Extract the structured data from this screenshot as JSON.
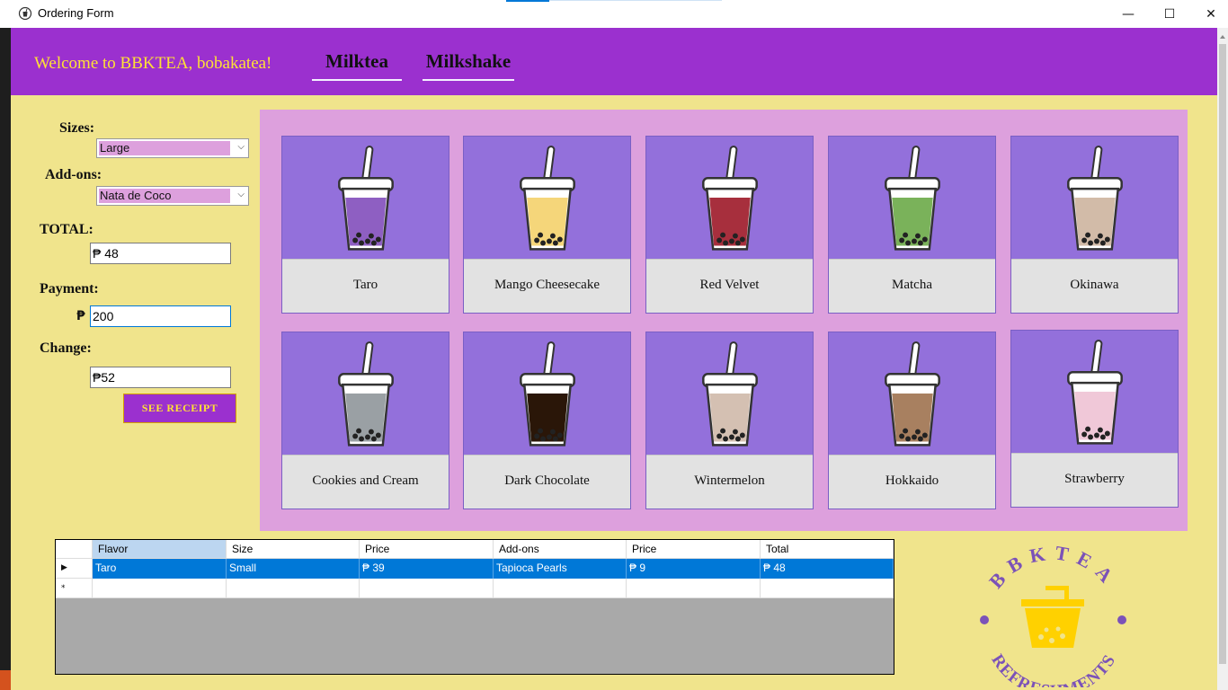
{
  "window": {
    "title": "Ordering Form",
    "controls": {
      "minimize": "—",
      "maximize": "☐",
      "close": "✕"
    }
  },
  "header": {
    "welcome": "Welcome to BBKTEA, bobakatea!",
    "tabs": [
      {
        "label": "Milktea"
      },
      {
        "label": "Milkshake"
      }
    ]
  },
  "order_form": {
    "sizes_label": "Sizes:",
    "size_value": "Large",
    "addons_label": "Add-ons:",
    "addon_value": "Nata de Coco",
    "total_label": "TOTAL:",
    "total_value": "₱ 48",
    "payment_label": "Payment:",
    "payment_currency": "₱",
    "payment_value": "200",
    "change_label": "Change:",
    "change_value": "₱52",
    "receipt_button": "SEE RECEIPT"
  },
  "products": [
    {
      "name": "Taro",
      "color": "#8e5fc2"
    },
    {
      "name": "Mango Cheesecake",
      "color": "#f5d67a"
    },
    {
      "name": "Red Velvet",
      "color": "#a72f3d"
    },
    {
      "name": "Matcha",
      "color": "#7ab25a"
    },
    {
      "name": "Okinawa",
      "color": "#d2bba8"
    },
    {
      "name": "Cookies and Cream",
      "color": "#9aa0a4"
    },
    {
      "name": "Dark Chocolate",
      "color": "#2a1608"
    },
    {
      "name": "Wintermelon",
      "color": "#d4c0b2"
    },
    {
      "name": "Hokkaido",
      "color": "#a88060"
    },
    {
      "name": "Strawberry",
      "color": "#f0c8d8"
    }
  ],
  "order_grid": {
    "columns": [
      "Flavor",
      "Size",
      "Price",
      "Add-ons",
      "Price",
      "Total"
    ],
    "rows": [
      [
        "Taro",
        "Small",
        "₱ 39",
        "Tapioca Pearls",
        "₱ 9",
        "₱ 48"
      ]
    ],
    "new_row_marker": "*"
  },
  "logo": {
    "top_text": "BBKTEA",
    "bottom_text": "REFRESHMENTS"
  },
  "colors": {
    "header_purple": "#9b30cf",
    "background_yellow": "#f0e48c",
    "panel_pink": "#dda0dd",
    "card_purple": "#9370db",
    "accent_yellow": "#ffe135",
    "logo_text": "#7b52b8",
    "selection_blue": "#0078d7"
  }
}
